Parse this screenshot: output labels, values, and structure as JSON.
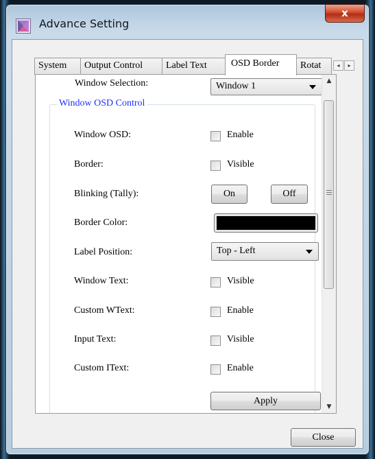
{
  "window": {
    "title": "Advance Setting",
    "close_glyph": "x"
  },
  "tabs": [
    {
      "label": "System"
    },
    {
      "label": "Output Control"
    },
    {
      "label": "Label Text"
    },
    {
      "label": "OSD Border"
    },
    {
      "label": "Rotat"
    }
  ],
  "tab_scroll": {
    "left": "◂",
    "right": "▸"
  },
  "panel": {
    "window_selection_label": "Window Selection:",
    "window_selection_value": "Window 1",
    "group_title": "Window OSD Control",
    "rows": {
      "window_osd": {
        "label": "Window OSD:",
        "option": "Enable"
      },
      "border": {
        "label": "Border:",
        "option": "Visible"
      },
      "blinking": {
        "label": "Blinking (Tally):",
        "on": "On",
        "off": "Off"
      },
      "border_color": {
        "label": "Border Color:",
        "color": "#000000"
      },
      "label_position": {
        "label": "Label Position:",
        "value": "Top - Left"
      },
      "window_text": {
        "label": "Window Text:",
        "option": "Visible"
      },
      "custom_wtext": {
        "label": "Custom WText:",
        "option": "Enable"
      },
      "input_text": {
        "label": "Input Text:",
        "option": "Visible"
      },
      "custom_itext": {
        "label": "Custom IText:",
        "option": "Enable"
      }
    },
    "apply_label": "Apply"
  },
  "scrollbar": {
    "up": "▲",
    "down": "▼"
  },
  "close_label": "Close"
}
